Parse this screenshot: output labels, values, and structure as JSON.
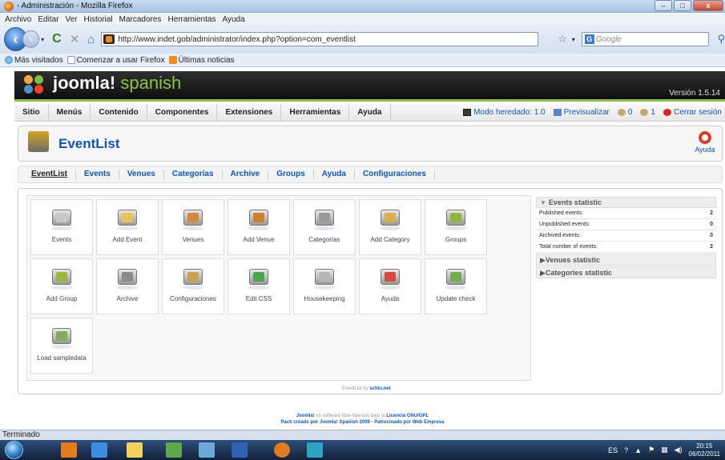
{
  "window": {
    "title": "- Administración - Mozilla Firefox",
    "controls": {
      "minimize": "–",
      "maximize": "□",
      "close": "x"
    }
  },
  "menubar": [
    "Archivo",
    "Editar",
    "Ver",
    "Historial",
    "Marcadores",
    "Herramientas",
    "Ayuda"
  ],
  "nav": {
    "url": "http://www.indet.gob/administrator/index.php?option=com_eventlist",
    "search_placeholder": "Google"
  },
  "bookmarks": [
    "Más visitados",
    "Comenzar a usar Firefox",
    "Últimas noticias"
  ],
  "joomla": {
    "brand": "joomla!",
    "brand_suffix": "spanish",
    "version": "Versión 1.5.14"
  },
  "admin_menu": {
    "items": [
      "Sitio",
      "Menús",
      "Contenido",
      "Componentes",
      "Extensiones",
      "Herramientas",
      "Ayuda"
    ],
    "status": {
      "legacy": "Modo heredado: 1.0",
      "preview": "Previsualizar",
      "messages": "0",
      "users": "1",
      "logout": "Cerrar sesión"
    }
  },
  "toolbar": {
    "title": "EventList",
    "help_label": "Ayuda"
  },
  "tabs": [
    "EventList",
    "Events",
    "Venues",
    "Categorías",
    "Archive",
    "Groups",
    "Ayuda",
    "Configuraciones"
  ],
  "tiles": [
    {
      "label": "Events",
      "color": "#c8c8c8"
    },
    {
      "label": "Add Event",
      "color": "#e7c35a"
    },
    {
      "label": "Venues",
      "color": "#d28b3a"
    },
    {
      "label": "Add Venue",
      "color": "#c9822f"
    },
    {
      "label": "Categorías",
      "color": "#9a9a9a"
    },
    {
      "label": "Add Category",
      "color": "#d9b04a"
    },
    {
      "label": "Groups",
      "color": "#8fb73e"
    },
    {
      "label": "Add Group",
      "color": "#96b93a"
    },
    {
      "label": "Archive",
      "color": "#8a8a8a"
    },
    {
      "label": "Configuraciones",
      "color": "#caa24a"
    },
    {
      "label": "Edit CSS",
      "color": "#4aa64a"
    },
    {
      "label": "Housekeeping",
      "color": "#b5b5b5"
    },
    {
      "label": "Ayuda",
      "color": "#d8473a"
    },
    {
      "label": "Update check",
      "color": "#6fae4b"
    },
    {
      "label": "Load sampledata",
      "color": "#7fae55"
    }
  ],
  "stats": {
    "events_heading": "Events statistic",
    "rows": [
      {
        "label": "Published events:",
        "value": "2"
      },
      {
        "label": "Unpublished events:",
        "value": "0"
      },
      {
        "label": "Archived events:",
        "value": "0"
      },
      {
        "label": "Total number of events:",
        "value": "2"
      }
    ],
    "venues_heading": "Venues statistic",
    "categories_heading": "Categories statistic"
  },
  "eventlist_credit": {
    "text": "EventList by",
    "link": "schlu.net"
  },
  "footer": {
    "line1_a": "Joomla!",
    "line1_b": "es software libre liberado bajo la",
    "line1_c": "Licencia GNU/GPL",
    "line2": "Pack creado por Joomla! Spanish 2009 - Patrocinado por Web Empresa"
  },
  "statusbar": "Terminado",
  "tray": {
    "lang": "ES",
    "time": "20:15",
    "date": "06/02/2011"
  }
}
